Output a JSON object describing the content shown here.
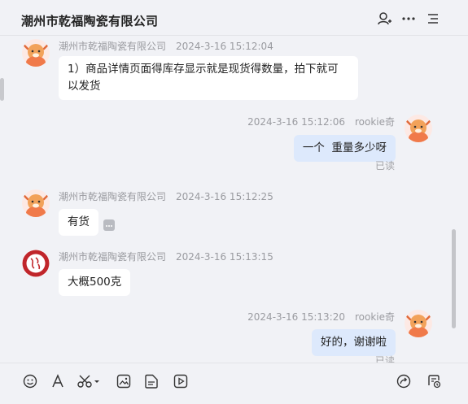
{
  "header": {
    "title": "潮州市乾福陶瓷有限公司",
    "icons": [
      "user-plus-icon",
      "more-icon",
      "menu-list-icon"
    ]
  },
  "messages": [
    {
      "sender": "潮州市乾福陶瓷有限公司",
      "time": "2024-3-16 15:12:04",
      "text_line1": "1）商品详情页面得库存显示就是现货得数量，拍下就可",
      "text_line2": "以发货"
    },
    {
      "sender": "rookie奇",
      "time": "2024-3-16 15:12:06",
      "text": "一个  重量多少呀",
      "status": "已读"
    },
    {
      "sender": "潮州市乾福陶瓷有限公司",
      "time": "2024-3-16 15:12:25",
      "text": "有货"
    },
    {
      "sender": "潮州市乾福陶瓷有限公司",
      "time": "2024-3-16 15:13:15",
      "text": "大概500克"
    },
    {
      "sender": "rookie奇",
      "time": "2024-3-16 15:13:20",
      "text": "好的，谢谢啦",
      "status": "已读"
    }
  ],
  "toolbar": {
    "icons": [
      "emoji-icon",
      "font-icon",
      "scissors-icon",
      "image-icon",
      "file-icon",
      "video-icon",
      "share-icon",
      "history-icon"
    ]
  },
  "colors": {
    "background": "#f1f2f6",
    "bubble_in": "#ffffff",
    "bubble_out": "#dde9fc",
    "meta_text": "#9a9ba0"
  }
}
